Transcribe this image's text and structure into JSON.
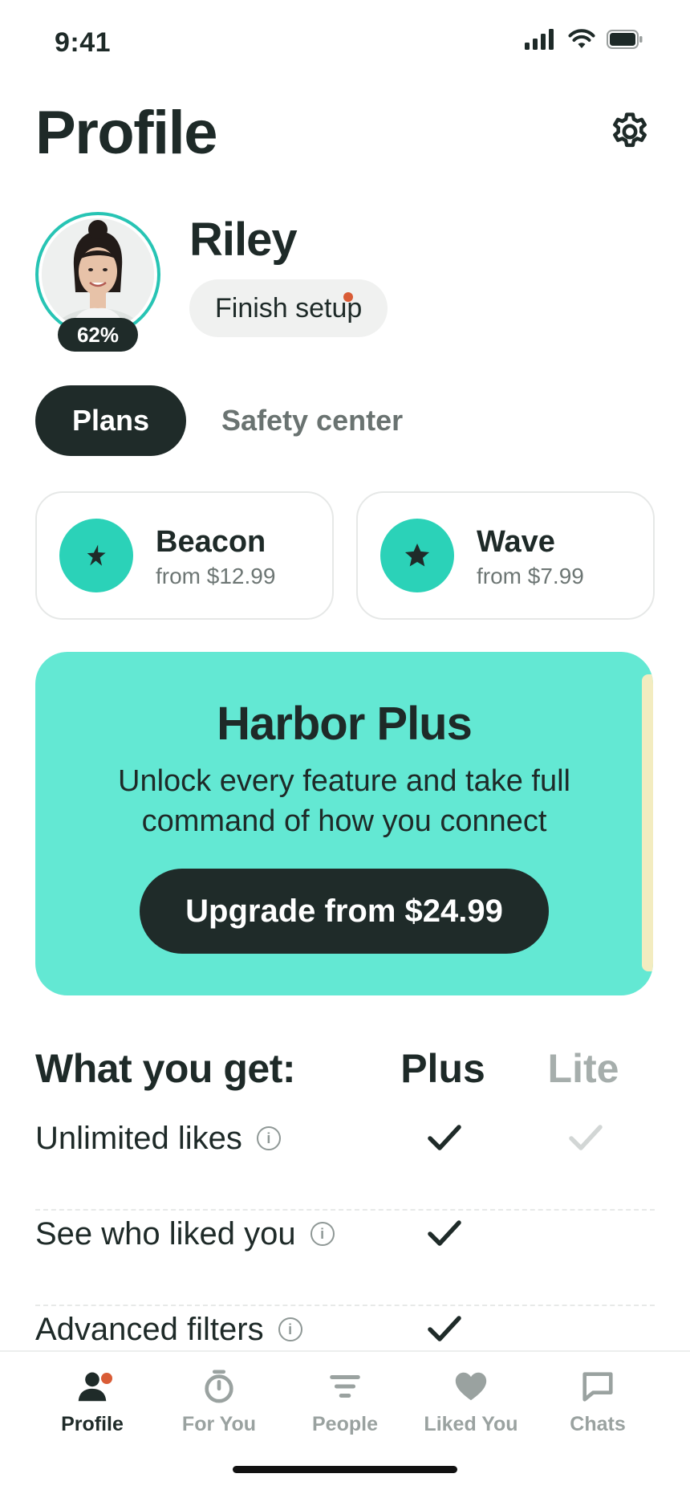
{
  "status_bar": {
    "time": "9:41"
  },
  "header": {
    "title": "Profile"
  },
  "profile": {
    "name": "Riley",
    "completion": "62%",
    "finish_setup_label": "Finish setup"
  },
  "tabs": [
    {
      "label": "Plans",
      "active": true
    },
    {
      "label": "Safety center",
      "active": false
    }
  ],
  "plans": [
    {
      "name": "Beacon",
      "price": "from $12.99",
      "icon": "star-icon"
    },
    {
      "name": "Wave",
      "price": "from $7.99",
      "icon": "star-icon"
    }
  ],
  "promo": {
    "title": "Harbor Plus",
    "subtitle": "Unlock every feature and take full command of how you connect",
    "cta": "Upgrade from $24.99"
  },
  "compare": {
    "title": "What you get:",
    "col_plus": "Plus",
    "col_lite": "Lite",
    "rows": [
      {
        "label": "Unlimited likes",
        "plus": true,
        "lite": true
      },
      {
        "label": "See who liked you",
        "plus": true,
        "lite": false
      },
      {
        "label": "Advanced filters",
        "plus": true,
        "lite": false
      }
    ]
  },
  "nav": [
    {
      "label": "Profile",
      "icon": "person-icon",
      "active": true,
      "badge": true
    },
    {
      "label": "For You",
      "icon": "timer-icon",
      "active": false
    },
    {
      "label": "People",
      "icon": "filter-lines-icon",
      "active": false
    },
    {
      "label": "Liked You",
      "icon": "heart-icon",
      "active": false
    },
    {
      "label": "Chats",
      "icon": "chat-bubble-icon",
      "active": false
    }
  ],
  "colors": {
    "accent": "#2bd2b8",
    "promo_bg": "#63e8d3",
    "dark": "#1f2b29",
    "badge": "#d95c36"
  }
}
